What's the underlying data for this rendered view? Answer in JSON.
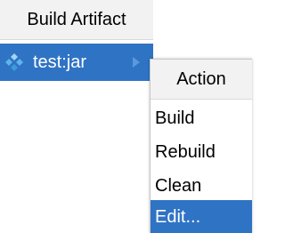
{
  "build_artifact_popup": {
    "title": "Build Artifact",
    "items": [
      {
        "label": "test:jar",
        "icon": "artifact-diamond-icon",
        "has_submenu": true,
        "selected": true
      }
    ]
  },
  "action_popup": {
    "title": "Action",
    "items": [
      {
        "label": "Build",
        "selected": false
      },
      {
        "label": "Rebuild",
        "selected": false
      },
      {
        "label": "Clean",
        "selected": false
      },
      {
        "label": "Edit...",
        "selected": true
      }
    ]
  },
  "colors": {
    "selection": "#2f73c4",
    "header_bg": "#f2f2f2",
    "icon_blue": "#5fb4e8"
  }
}
